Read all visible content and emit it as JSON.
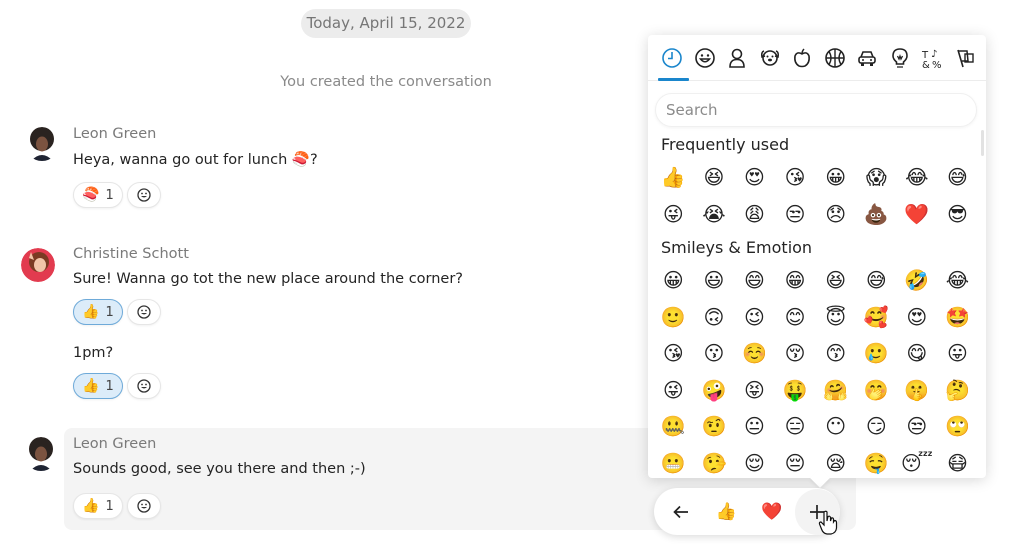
{
  "conversation": {
    "date_divider": "Today, April 15, 2022",
    "system_message": "You created the conversation",
    "messages": [
      {
        "sender": "Leon Green",
        "avatar": "leon-green-avatar",
        "text": "Heya, wanna go out for lunch 🍣?",
        "reactions": [
          {
            "emoji": "🍣",
            "count": "1",
            "selected": false
          }
        ],
        "add_reaction_icon": "smiley-add-icon"
      },
      {
        "sender": "Christine Schott",
        "avatar": "christine-schott-avatar",
        "text": "Sure! Wanna go tot the new place around the corner?",
        "reactions": [
          {
            "emoji": "👍",
            "count": "1",
            "selected": true
          }
        ],
        "add_reaction_icon": "smiley-add-icon"
      },
      {
        "sender": "",
        "text": "1pm?",
        "reactions": [
          {
            "emoji": "👍",
            "count": "1",
            "selected": true
          }
        ],
        "add_reaction_icon": "smiley-add-icon"
      },
      {
        "sender": "Leon Green",
        "avatar": "leon-green-avatar",
        "text": "Sounds good, see you there and then ;-)",
        "reactions": [
          {
            "emoji": "👍",
            "count": "1",
            "selected": false
          }
        ],
        "add_reaction_icon": "smiley-add-icon",
        "highlighted": true
      }
    ]
  },
  "emoji_picker": {
    "categories": [
      {
        "name": "recent",
        "icon": "clock-icon",
        "active": true
      },
      {
        "name": "smileys",
        "icon": "smiley-icon",
        "active": false
      },
      {
        "name": "people",
        "icon": "person-icon",
        "active": false
      },
      {
        "name": "animals",
        "icon": "dog-icon",
        "active": false
      },
      {
        "name": "food",
        "icon": "apple-icon",
        "active": false
      },
      {
        "name": "activities",
        "icon": "basketball-icon",
        "active": false
      },
      {
        "name": "travel",
        "icon": "car-icon",
        "active": false
      },
      {
        "name": "objects",
        "icon": "lightbulb-icon",
        "active": false
      },
      {
        "name": "symbols",
        "icon": "symbols-icon",
        "active": false
      },
      {
        "name": "flags",
        "icon": "flags-icon",
        "active": false
      }
    ],
    "search_placeholder": "Search",
    "search_value": "",
    "sections": [
      {
        "title": "Frequently used",
        "emojis": [
          "👍",
          "😆",
          "😍",
          "😘",
          "😀",
          "😱",
          "😂",
          "😅",
          "😜",
          "😭",
          "😩",
          "😒",
          "😞",
          "💩",
          "❤️",
          "😎"
        ]
      },
      {
        "title": "Smileys & Emotion",
        "emojis": [
          "😀",
          "😃",
          "😄",
          "😁",
          "😆",
          "😅",
          "🤣",
          "😂",
          "🙂",
          "🙃",
          "😉",
          "😊",
          "😇",
          "🥰",
          "😍",
          "🤩",
          "😘",
          "😗",
          "☺️",
          "😚",
          "😙",
          "🥲",
          "😋",
          "😛",
          "😜",
          "🤪",
          "😝",
          "🤑",
          "🤗",
          "🤭",
          "🤫",
          "🤔",
          "🤐",
          "🤨",
          "😐",
          "😑",
          "😶",
          "😏",
          "😒",
          "🙄",
          "😬",
          "🤥",
          "😌",
          "😔",
          "😪",
          "🤤",
          "😴",
          "😷"
        ]
      }
    ],
    "accent_color": "#1a86cc"
  },
  "quick_reactions": {
    "back_icon": "arrow-left-icon",
    "emojis": [
      "👍",
      "❤️"
    ],
    "more_icon": "plus-icon"
  }
}
